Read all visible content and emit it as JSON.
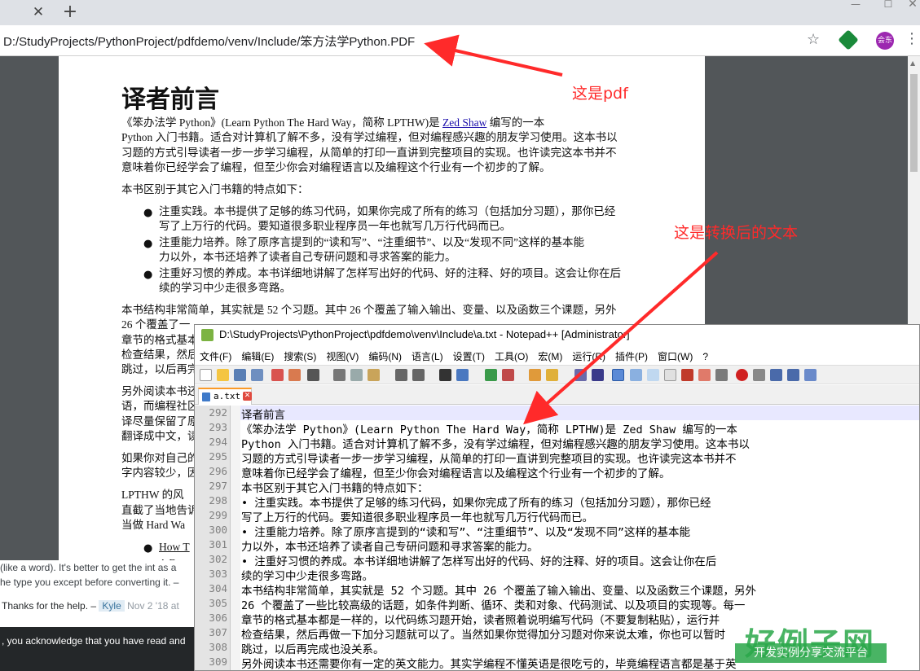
{
  "browser": {
    "url": "D:/StudyProjects/PythonProject/pdfdemo/venv/Include/笨方法学Python.PDF",
    "tab_close": "✕",
    "new_tab": "+",
    "avatar_label": "会东"
  },
  "pdf": {
    "heading": "译者前言",
    "intro_l1_a": "《笨办法学 Python》(Learn Python The Hard Way，简称 LPTHW)是 ",
    "intro_link": "Zed Shaw",
    "intro_l1_b": " 编写的一本",
    "intro_l2": "Python 入门书籍。适合对计算机了解不多，没有学过编程，但对编程感兴趣的朋友学习使用。这本书以",
    "intro_l3": "习题的方式引导读者一步一步学习编程，从简单的打印一直讲到完整项目的实现。也许读完这本书并不",
    "intro_l4": "意味着你已经学会了编程，但至少你会对编程语言以及编程这个行业有一个初步的了解。",
    "features_title": "本书区别于其它入门书籍的特点如下：",
    "b1_l1": "注重实践。本书提供了足够的练习代码，如果你完成了所有的练习（包括加分习题），那你已经",
    "b1_l2": "写了上万行的代码。要知道很多职业程序员一年也就写几万行代码而已。",
    "b2_l1": "注重能力培养。除了原序言提到的“读和写”、“注重细节”、以及“发现不同”这样的基本能",
    "b2_l2": "力以外，本书还培养了读者自己专研问题和寻求答案的能力。",
    "b3_l1": "注重好习惯的养成。本书详细地讲解了怎样写出好的代码、好的注释、好的项目。这会让你在后",
    "b3_l2": "续的学习中少走很多弯路。",
    "struct_l1": "本书结构非常简单，其实就是 52 个习题。其中 26 个覆盖了输入输出、变量、以及函数三个课题，另外",
    "struct_l2": "26 个覆盖了一",
    "struct_l3": "章节的格式基本",
    "struct_l4": "检查结果，然后",
    "struct_l5": "跳过，以后再完",
    "read_l1": "另外阅读本书还",
    "read_l2": "语，而编程社区",
    "read_l3": "译尽量保留了原",
    "read_l4": "翻译成中文，读",
    "if_l1": "如果你对自己的",
    "if_l2": "字内容较少，因",
    "lpthw_l1": "LPTHW 的风",
    "lpthw_l2": "直截了当地告诉",
    "lpthw_l3": "当做  Hard Wa",
    "link1": "How T",
    "link2": "A Byte"
  },
  "stackoverflow": {
    "line1": "(like a word). It's better to get the int as a",
    "line2": "he type you except before converting it. –",
    "comment": "Thanks for the help. –",
    "user": "Kyle",
    "date": "Nov 2 '18 at",
    "cookie": ", you acknowledge that you have read and"
  },
  "notepad": {
    "title": "D:\\StudyProjects\\PythonProject\\pdfdemo\\venv\\Include\\a.txt - Notepad++ [Administrator]",
    "menu": [
      "文件(F)",
      "编辑(E)",
      "搜索(S)",
      "视图(V)",
      "编码(N)",
      "语言(L)",
      "设置(T)",
      "工具(O)",
      "宏(M)",
      "运行(R)",
      "插件(P)",
      "窗口(W)",
      "?"
    ],
    "tab_label": "a.txt",
    "lines": [
      {
        "n": "292",
        "t": "译者前言"
      },
      {
        "n": "293",
        "t": "《笨办法学 Python》(Learn Python The Hard Way，简称 LPTHW)是 Zed Shaw 编写的一本"
      },
      {
        "n": "294",
        "t": "Python 入门书籍。适合对计算机了解不多，没有学过编程，但对编程感兴趣的朋友学习使用。这本书以"
      },
      {
        "n": "295",
        "t": "习题的方式引导读者一步一步学习编程，从简单的打印一直讲到完整项目的实现。也许读完这本书并不"
      },
      {
        "n": "296",
        "t": "意味着你已经学会了编程，但至少你会对编程语言以及编程这个行业有一个初步的了解。"
      },
      {
        "n": "297",
        "t": "本书区别于其它入门书籍的特点如下："
      },
      {
        "n": "298",
        "t": "• 注重实践。本书提供了足够的练习代码，如果你完成了所有的练习（包括加分习题），那你已经"
      },
      {
        "n": "299",
        "t": "写了上万行的代码。要知道很多职业程序员一年也就写几万行代码而已。"
      },
      {
        "n": "300",
        "t": "• 注重能力培养。除了原序言提到的“读和写”、“注重细节”、以及“发现不同”这样的基本能"
      },
      {
        "n": "301",
        "t": "力以外，本书还培养了读者自己专研问题和寻求答案的能力。"
      },
      {
        "n": "302",
        "t": "• 注重好习惯的养成。本书详细地讲解了怎样写出好的代码、好的注释、好的项目。这会让你在后"
      },
      {
        "n": "303",
        "t": "续的学习中少走很多弯路。"
      },
      {
        "n": "304",
        "t": "本书结构非常简单，其实就是 52 个习题。其中 26 个覆盖了输入输出、变量、以及函数三个课题，另外"
      },
      {
        "n": "305",
        "t": "26 个覆盖了一些比较高级的话题，如条件判断、循环、类和对象、代码测试、以及项目的实现等。每一"
      },
      {
        "n": "306",
        "t": "章节的格式基本都是一样的，以代码练习题开始，读者照着说明编写代码（不要复制粘贴），运行并"
      },
      {
        "n": "307",
        "t": "检查结果，然后再做一下加分习题就可以了。当然如果你觉得加分习题对你来说太难，你也可以暂时"
      },
      {
        "n": "308",
        "t": "跳过，以后再完成也没关系。"
      },
      {
        "n": "309",
        "t": "另外阅读本书还需要你有一定的英文能力。其实学编程不懂英语是很吃亏的，毕竟编程语言都是基于英"
      }
    ]
  },
  "annotations": {
    "pdf_label": "这是pdf",
    "txt_label": "这是转换后的文本",
    "color": "#ff2a2a"
  },
  "watermark": {
    "big": "好例子网",
    "small": "开发实例分享交流平台"
  }
}
